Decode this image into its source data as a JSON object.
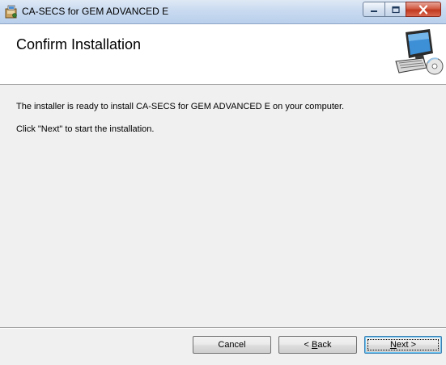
{
  "window": {
    "title": "CA-SECS for GEM ADVANCED E",
    "app_icon": "installer-icon",
    "caption_buttons": [
      "minimize-icon",
      "maximize-icon",
      "close-icon"
    ]
  },
  "banner": {
    "title": "Confirm Installation",
    "image": "computer-setup-icon"
  },
  "body": {
    "line1": "The installer is ready to install CA-SECS for GEM ADVANCED E on your computer.",
    "line2": "Click \"Next\" to start the installation."
  },
  "buttons": {
    "cancel": "Cancel",
    "back_prefix": "< ",
    "back_mnemonic": "B",
    "back_rest": "ack",
    "next_mnemonic": "N",
    "next_rest": "ext >"
  },
  "colors": {
    "titlebar": "#c9daf0",
    "close_button": "#c0391f",
    "dialog_background": "#f0f0f0",
    "banner_background": "#ffffff",
    "default_button_border": "#3c7fb1"
  }
}
